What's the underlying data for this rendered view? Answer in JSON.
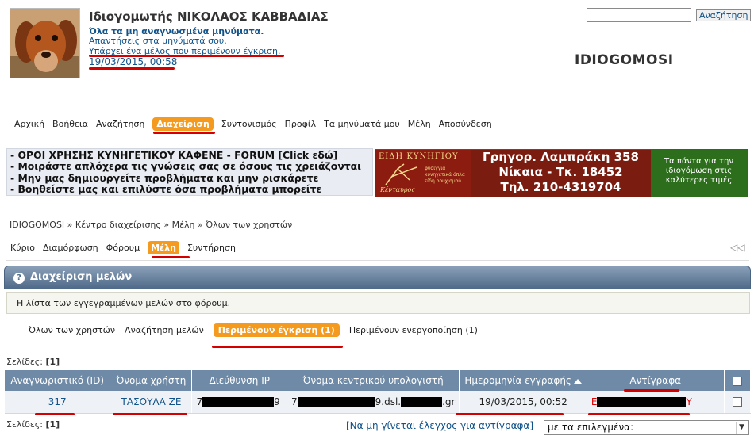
{
  "header": {
    "user_title": "Ιδιογομωτής ΝΙΚΟΛΑΟΣ ΚΑΒΒΑΔΙΑΣ",
    "unread": "Όλα τα μη αναγνωσμένα μηνύματα.",
    "replies": "Απαντήσεις στα μηνύματά σου.",
    "pending": "Υπάρχει ένα μέλος που περιμένουν έγκριση.",
    "date": "19/03/2015, 00:58",
    "site_title": "IDIOGOMOSI",
    "search_button": "Αναζήτηση",
    "search_value": ""
  },
  "main_nav": [
    "Αρχική",
    "Βοήθεια",
    "Αναζήτηση",
    "Διαχείριση",
    "Συντονισμός",
    "Προφίλ",
    "Τα μηνύματά μου",
    "Μέλη",
    "Αποσύνδεση"
  ],
  "rules_banner": [
    "- ΟΡΟΙ ΧΡΗΣΗΣ ΚΥΝΗΓΕΤΙΚΟΥ ΚΑΦΕΝΕ - FORUM [Click εδώ]",
    "- Μοιράστε απλόχερα τις γνώσεις σας σε όσους τις χρειάζονται",
    "- Μην μας δημιουργείτε προβλήματα και μην ρισκάρετε",
    "- Βοηθείστε μας και επιλύστε όσα προβλήματα μπορείτε"
  ],
  "ad": {
    "brand": "ΕΙΔΗ ΚΥΝΗΓΙΟΥ",
    "items": [
      "φυσίγγια",
      "κυνηγετικά όπλα",
      "είδη ρουχισμού"
    ],
    "sub": "Κένταυρος",
    "address": [
      "Γρηγορ. Λαμπράκη 358",
      "Νίκαια - Τκ. 18452",
      "Τηλ. 210-4319704"
    ],
    "slogan": [
      "Τα πάντα για την",
      "ιδιογόμωση στις",
      "καλύτερες τιμές"
    ]
  },
  "breadcrumb": "IDIOGOMOSI » Κέντρο διαχείρισης » Μέλη » Όλων των χρηστών",
  "acp_tabs": [
    "Κύριο",
    "Διαμόρφωση",
    "Φόρουμ",
    "Μέλη",
    "Συντήρηση"
  ],
  "section": {
    "title": "Διαχείριση μελών",
    "description": "Η λίστα των εγγεγραμμένων μελών στο φόρουμ."
  },
  "sub_tabs": [
    "Όλων των χρηστών",
    "Αναζήτηση μελών",
    "Περιμένουν έγκριση (1)",
    "Περιμένουν ενεργοποίηση (1)"
  ],
  "pages": {
    "label": "Σελίδες:",
    "value": "[1]"
  },
  "table": {
    "headers": [
      "Αναγνωριστικό (ID)",
      "Όνομα χρήστη",
      "Διεύθυνση IP",
      "Όνομα κεντρικού υπολογιστή",
      "Ημερομηνία εγγραφής",
      "Αντίγραφα"
    ],
    "row": {
      "id": "317",
      "username": "ΤΑΣΟΥΛΑ ΖΕ",
      "ip_start": "7",
      "ip_end": "9",
      "host_start": "7",
      "host_end": "9.dsl.",
      "host_tail": ".gr",
      "date": "19/03/2015, 00:52",
      "copies_start": "E",
      "copies_end": "Y"
    }
  },
  "footer": {
    "no_verify": "[Να μη γίνεται έλεγχος για αντίγραφα]",
    "select_value": "με τα επιλεγμένα:"
  }
}
